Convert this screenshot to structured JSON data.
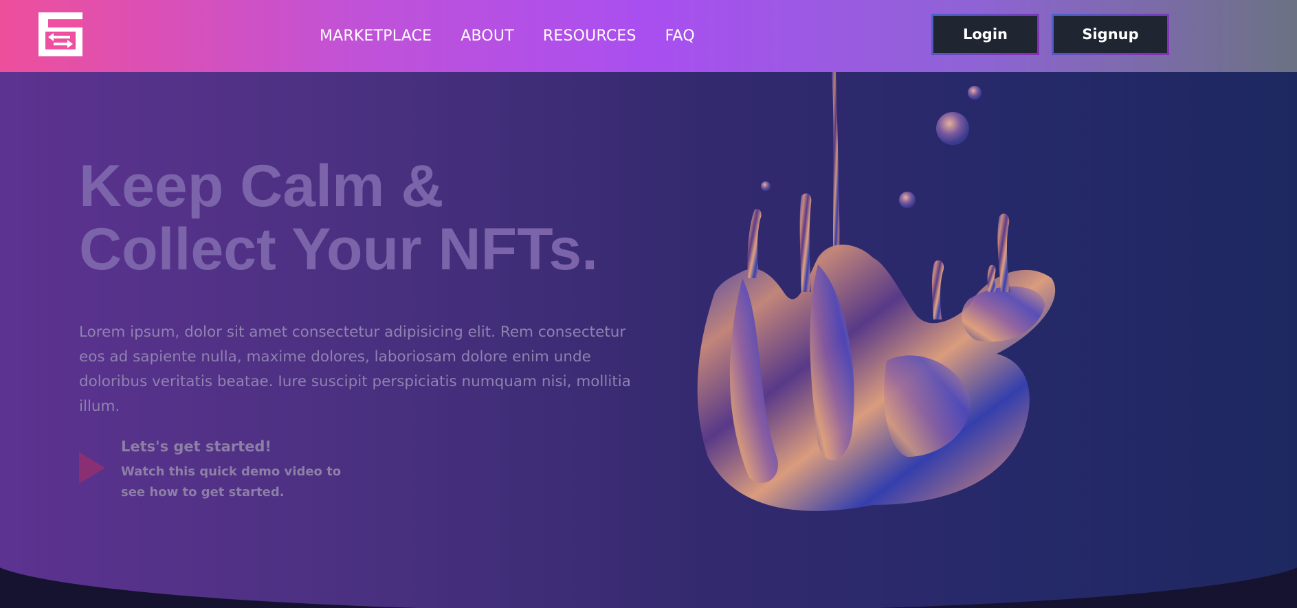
{
  "nav": {
    "logo_icon": "swap-arrows-logo-icon",
    "links": [
      "MARKETPLACE",
      "ABOUT",
      "RESOURCES",
      "FAQ"
    ],
    "login_label": "Login",
    "signup_label": "Signup"
  },
  "hero": {
    "headline_line1": "Keep Calm &",
    "headline_line2": "Collect Your NFTs.",
    "description": "Lorem ipsum, dolor sit amet consectetur adipisicing elit. Rem consectetur eos ad sapiente nulla, maxime dolores, laboriosam dolore enim unde doloribus veritatis beatae. Iure suscipit perspiciatis numquam nisi, mollitia illum.",
    "cta_title": "Lets's get started!",
    "cta_subtitle": "Watch this quick demo video to see how to get started.",
    "play_icon": "play-icon",
    "art_icon": "liquid-metal-splash-illustration"
  },
  "colors": {
    "nav_gradient": [
      "#ee4f9b",
      "#c052d8",
      "#a94ff0",
      "#8f63d6",
      "#6b7283"
    ],
    "hero_gradient": [
      "#5d3391",
      "#33296e",
      "#1d2860"
    ],
    "button_bg": "#1f2632",
    "headline": "#7b64a9",
    "play_icon": "#8b2f74"
  }
}
